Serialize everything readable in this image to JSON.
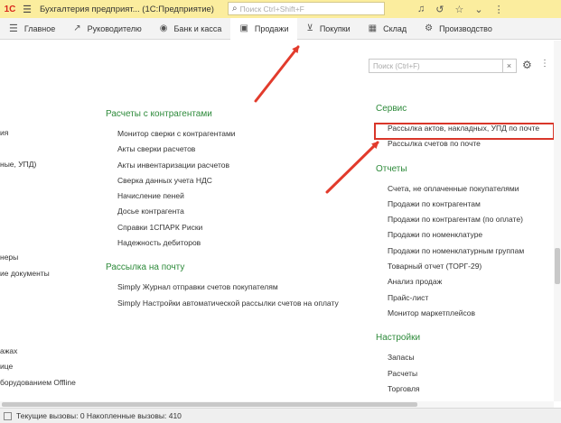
{
  "titlebar": {
    "logo": "1С",
    "title": "Бухгалтерия предприят...   (1С:Предприятие)",
    "search_placeholder": "Поиск Ctrl+Shift+F"
  },
  "tabs": [
    {
      "label": "Главное",
      "icon": "hamburger-icon"
    },
    {
      "label": "Руководителю",
      "icon": "trend-icon"
    },
    {
      "label": "Банк и касса",
      "icon": "coins-icon"
    },
    {
      "label": "Продажи",
      "icon": "bag-icon"
    },
    {
      "label": "Покупки",
      "icon": "cart-icon"
    },
    {
      "label": "Склад",
      "icon": "warehouse-icon"
    },
    {
      "label": "Производство",
      "icon": "factory-icon"
    }
  ],
  "search": {
    "placeholder": "Поиск (Ctrl+F)",
    "clear": "×"
  },
  "left_partial": {
    "items": [
      "ия",
      "",
      "ные, УПД)",
      "",
      "",
      "",
      "",
      "",
      "неры",
      "ие документы",
      "",
      "",
      "",
      "",
      "ажах",
      "ице",
      "борудованием Offline"
    ]
  },
  "mid": {
    "sections": [
      {
        "title": "Расчеты с контрагентами",
        "items": [
          "Монитор сверки с контрагентами",
          "Акты сверки расчетов",
          "Акты инвентаризации расчетов",
          "Сверка данных учета НДС",
          "Начисление пеней",
          "Досье контрагента",
          "Справки 1СПАРК Риски",
          "Надежность дебиторов"
        ]
      },
      {
        "title": "Рассылка на почту",
        "items": [
          "Simply Журнал отправки счетов покупателям",
          "Simply Настройки автоматической рассылки счетов на оплату"
        ]
      }
    ]
  },
  "right": {
    "sections": [
      {
        "title": "Сервис",
        "items": [
          "Рассылка актов, накладных, УПД по почте",
          "Рассылка счетов по почте"
        ]
      },
      {
        "title": "Отчеты",
        "items": [
          "Счета, не оплаченные покупателями",
          "Продажи по контрагентам",
          "Продажи по контрагентам (по оплате)",
          "Продажи по номенклатуре",
          "Продажи по номенклатурным группам",
          "Товарный отчет (ТОРГ-29)",
          "Анализ продаж",
          "Прайс-лист",
          "Монитор маркетплейсов"
        ]
      },
      {
        "title": "Настройки",
        "items": [
          "Запасы",
          "Расчеты",
          "Торговля"
        ]
      }
    ]
  },
  "status": {
    "text": "Текущие вызовы: 0   Накопленные вызовы: 410"
  },
  "colors": {
    "heading": "#2d8a3a",
    "titlebar": "#fbed9e",
    "highlight": "#d9362a"
  }
}
